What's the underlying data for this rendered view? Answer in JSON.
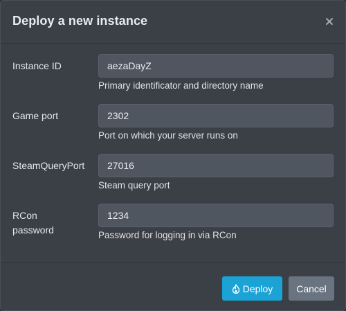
{
  "dialog": {
    "title": "Deploy a new instance",
    "close_icon": "close-icon"
  },
  "fields": [
    {
      "label": "Instance ID",
      "value": "aezaDayZ",
      "help": "Primary identificator and directory name"
    },
    {
      "label": "Game port",
      "value": "2302",
      "help": "Port on which your server runs on"
    },
    {
      "label": "SteamQueryPort",
      "value": "27016",
      "help": "Steam query port"
    },
    {
      "label_line1": "RCon",
      "label_line2": "password",
      "value": "1234",
      "help": "Password for logging in via RCon"
    }
  ],
  "footer": {
    "deploy_label": "Deploy",
    "deploy_icon": "flame-icon",
    "cancel_label": "Cancel"
  },
  "colors": {
    "modal_bg": "#3b3f46",
    "input_bg": "#4f5660",
    "primary": "#1ba3d6",
    "secondary": "#6a7480"
  }
}
